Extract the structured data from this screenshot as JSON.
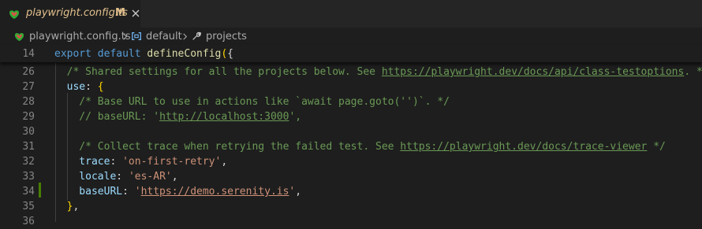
{
  "tab": {
    "title": "playwright.config.ts",
    "status": "M"
  },
  "breadcrumb": {
    "file": "playwright.config.ts",
    "symbol1": "default",
    "symbol2": "projects"
  },
  "lines": [
    {
      "num": "14",
      "parts": [
        [
          "k",
          "export "
        ],
        [
          "k",
          "default "
        ],
        [
          "f",
          "defineConfig"
        ],
        [
          "y",
          "("
        ],
        [
          "p",
          "{"
        ]
      ]
    },
    {
      "num": "26",
      "parts": [
        [
          "c",
          "  /* Shared settings for all the projects below. See "
        ],
        [
          "cu",
          "https://playwright.dev/docs/api/class-testoptions"
        ],
        [
          "c",
          ". */"
        ]
      ]
    },
    {
      "num": "27",
      "parts": [
        [
          "v",
          "  use"
        ],
        [
          "p",
          ": "
        ],
        [
          "y",
          "{"
        ]
      ]
    },
    {
      "num": "28",
      "parts": [
        [
          "c",
          "    /* Base URL to use in actions like `await page.goto('')`. */"
        ]
      ]
    },
    {
      "num": "29",
      "parts": [
        [
          "c",
          "    // baseURL: '"
        ],
        [
          "cu",
          "http://localhost:3000"
        ],
        [
          "c",
          "',"
        ]
      ]
    },
    {
      "num": "30",
      "parts": []
    },
    {
      "num": "31",
      "parts": [
        [
          "c",
          "    /* Collect trace when retrying the failed test. See "
        ],
        [
          "cu",
          "https://playwright.dev/docs/trace-viewer"
        ],
        [
          "c",
          " */"
        ]
      ]
    },
    {
      "num": "32",
      "parts": [
        [
          "v",
          "    trace"
        ],
        [
          "p",
          ": "
        ],
        [
          "s",
          "'on-first-retry'"
        ],
        [
          "p",
          ","
        ]
      ]
    },
    {
      "num": "33",
      "parts": [
        [
          "v",
          "    locale"
        ],
        [
          "p",
          ": "
        ],
        [
          "s",
          "'es-AR'"
        ],
        [
          "p",
          ","
        ]
      ]
    },
    {
      "num": "34",
      "parts": [
        [
          "v",
          "    baseURL"
        ],
        [
          "p",
          ": "
        ],
        [
          "s",
          "'"
        ],
        [
          "su",
          "https://demo.serenity.is"
        ],
        [
          "s",
          "'"
        ],
        [
          "p",
          ","
        ]
      ]
    },
    {
      "num": "35",
      "parts": [
        [
          "y",
          "  }"
        ],
        [
          "p",
          ","
        ]
      ]
    },
    {
      "num": "36",
      "parts": []
    }
  ]
}
